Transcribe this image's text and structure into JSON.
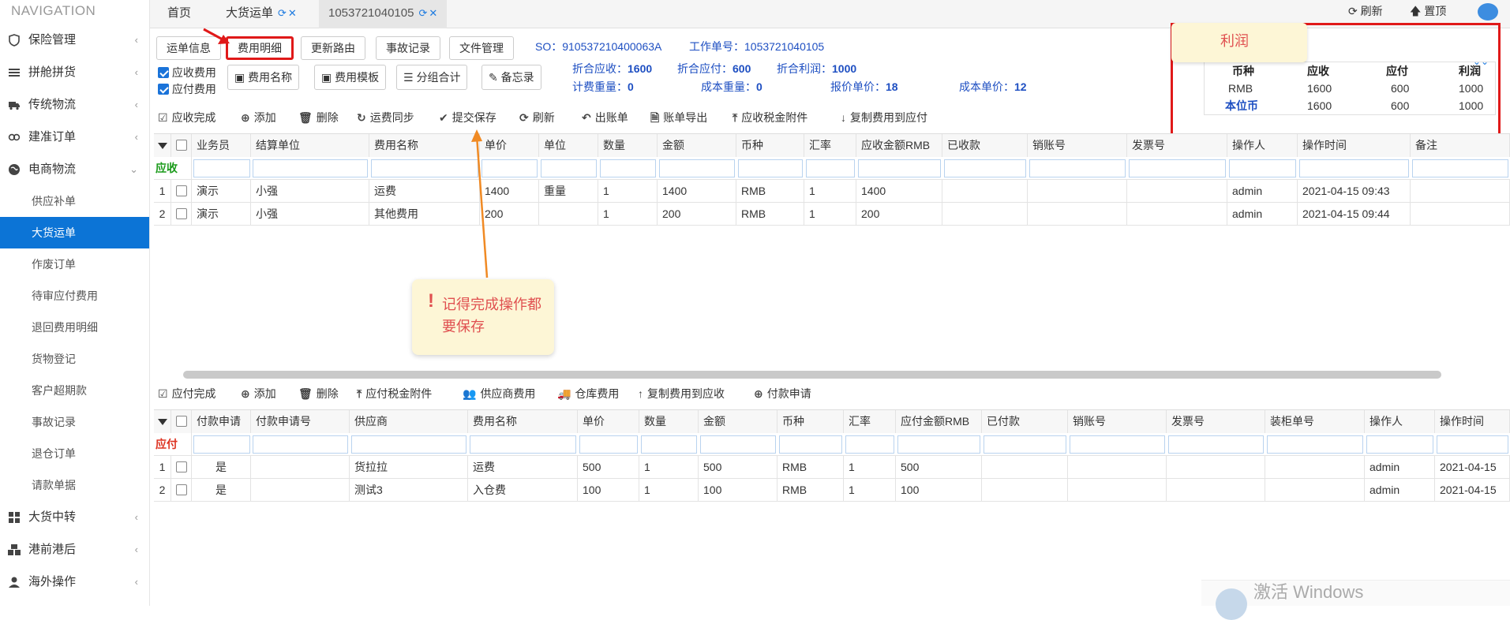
{
  "nav": {
    "title": "NAVIGATION",
    "items": [
      {
        "label": "保险管理",
        "icon": "shield-icon"
      },
      {
        "label": "拼舱拼货",
        "icon": "list-icon"
      },
      {
        "label": "传统物流",
        "icon": "truck-icon"
      },
      {
        "label": "建准订单",
        "icon": "link-icon"
      },
      {
        "label": "电商物流",
        "icon": "globe-icon"
      }
    ],
    "sub_items": [
      "供应补单",
      "大货运单",
      "作废订单",
      "待审应付费用",
      "退回费用明细",
      "货物登记",
      "客户超期款",
      "事故记录",
      "退仓订单",
      "请款单据"
    ],
    "active_sub": "大货运单",
    "more_items": [
      {
        "label": "大货中转",
        "icon": "grid-icon"
      },
      {
        "label": "港前港后",
        "icon": "cubes-icon"
      },
      {
        "label": "海外操作",
        "icon": "user-icon"
      }
    ]
  },
  "page_tabs": [
    {
      "label": "首页"
    },
    {
      "label": "大货运单"
    },
    {
      "label": "1053721040105"
    }
  ],
  "top_actions": {
    "refresh": "刷新",
    "top": "置顶"
  },
  "sub_tabs": [
    "运单信息",
    "费用明细",
    "更新路由",
    "事故记录",
    "文件管理"
  ],
  "order_info": {
    "so": "SO：910537210400063A",
    "work_no": "工作单号：1053721040105"
  },
  "options": {
    "receivable": "应收费用",
    "payable": "应付费用"
  },
  "option_buttons": [
    "费用名称",
    "费用模板",
    "分组合计",
    "备忘录"
  ],
  "metrics": {
    "row1": [
      {
        "label": "折合应收：",
        "value": "1600"
      },
      {
        "label": "折合应付：",
        "value": "600"
      },
      {
        "label": "折合利润：",
        "value": "1000"
      }
    ],
    "row2": [
      {
        "label": "计费重量：",
        "value": "0"
      },
      {
        "label": "成本重量：",
        "value": "0"
      },
      {
        "label": "报价单价：",
        "value": "18"
      },
      {
        "label": "成本单价：",
        "value": "12"
      }
    ]
  },
  "profit": {
    "label": "利润",
    "headers": [
      "币种",
      "应收",
      "应付",
      "利润"
    ],
    "rows": [
      [
        "RMB",
        "1600",
        "600",
        "1000"
      ],
      [
        "本位币",
        "1600",
        "600",
        "1000"
      ]
    ]
  },
  "recv_toolbar": [
    "应收完成",
    "添加",
    "删除",
    "运费同步",
    "提交保存",
    "刷新",
    "出账单",
    "账单导出",
    "应收税金附件",
    "复制费用到应付"
  ],
  "recv_table": {
    "filter_label": "应收",
    "headers": [
      "业务员",
      "结算单位",
      "费用名称",
      "单价",
      "单位",
      "数量",
      "金额",
      "币种",
      "汇率",
      "应收金额RMB",
      "已收款",
      "销账号",
      "发票号",
      "操作人",
      "操作时间",
      "备注"
    ],
    "rows": [
      [
        "1",
        "演示",
        "小强",
        "运费",
        "1400",
        "重量",
        "1",
        "1400",
        "RMB",
        "1",
        "1400",
        "",
        "",
        "",
        "admin",
        "2021-04-15 09:43",
        ""
      ],
      [
        "2",
        "演示",
        "小强",
        "其他费用",
        "200",
        "",
        "1",
        "200",
        "RMB",
        "1",
        "200",
        "",
        "",
        "",
        "admin",
        "2021-04-15 09:44",
        ""
      ]
    ]
  },
  "note": {
    "text": "记得完成操作都要保存"
  },
  "pay_toolbar": [
    "应付完成",
    "添加",
    "删除",
    "应付税金附件",
    "供应商费用",
    "仓库费用",
    "复制费用到应收",
    "付款申请"
  ],
  "pay_table": {
    "filter_label": "应付",
    "headers": [
      "付款申请",
      "付款申请号",
      "供应商",
      "费用名称",
      "单价",
      "数量",
      "金额",
      "币种",
      "汇率",
      "应付金额RMB",
      "已付款",
      "销账号",
      "发票号",
      "装柜单号",
      "操作人",
      "操作时间"
    ],
    "rows": [
      [
        "1",
        "是",
        "",
        "货拉拉",
        "运费",
        "500",
        "1",
        "500",
        "RMB",
        "1",
        "500",
        "",
        "",
        "",
        "",
        "admin",
        "2021-04-15"
      ],
      [
        "2",
        "是",
        "",
        "测试3",
        "入仓费",
        "100",
        "1",
        "100",
        "RMB",
        "1",
        "100",
        "",
        "",
        "",
        "",
        "admin",
        "2021-04-15"
      ]
    ]
  },
  "watermark": "激活 Windows"
}
